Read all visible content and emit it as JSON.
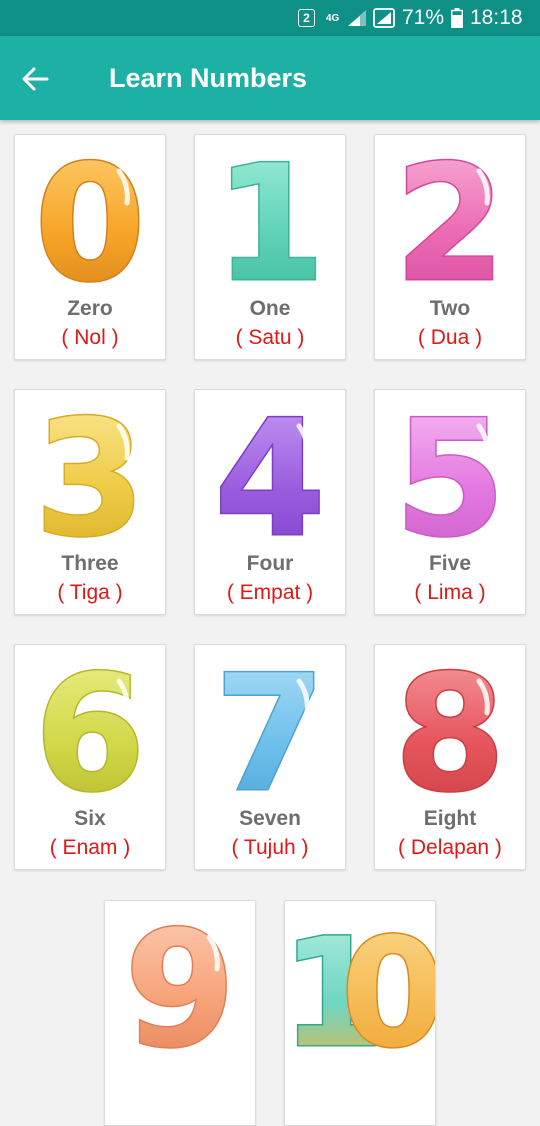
{
  "status_bar": {
    "sim_slot": "2",
    "network_type": "4G",
    "battery_percent": "71%",
    "time": "18:18",
    "icons": [
      "sim-slot-icon",
      "signal-icon",
      "data-icon",
      "battery-icon"
    ]
  },
  "app_bar": {
    "title": "Learn Numbers",
    "back_icon": "arrow-left-icon"
  },
  "cards": [
    {
      "digit": "0",
      "english": "Zero",
      "indonesian": "( Nol )",
      "color": "#f7a528",
      "light": "#ffd277",
      "dark": "#d6801a"
    },
    {
      "digit": "1",
      "english": "One",
      "indonesian": "( Satu )",
      "color": "#5fd3b8",
      "light": "#a6f0dd",
      "dark": "#3cb497"
    },
    {
      "digit": "2",
      "english": "Two",
      "indonesian": "( Dua )",
      "color": "#ec6bb3",
      "light": "#f9b5da",
      "dark": "#d3479a"
    },
    {
      "digit": "3",
      "english": "Three",
      "indonesian": "( Tiga )",
      "color": "#efcc46",
      "light": "#fbe99a",
      "dark": "#d5ac22"
    },
    {
      "digit": "4",
      "english": "Four",
      "indonesian": "( Empat )",
      "color": "#9b5de0",
      "light": "#c9a0f4",
      "dark": "#7a3fc4"
    },
    {
      "digit": "5",
      "english": "Five",
      "indonesian": "( Lima )",
      "color": "#e479e1",
      "light": "#f7c3f4",
      "dark": "#c95cc5"
    },
    {
      "digit": "6",
      "english": "Six",
      "indonesian": "( Enam )",
      "color": "#d2d848",
      "light": "#ecf08f",
      "dark": "#b3b82a"
    },
    {
      "digit": "7",
      "english": "Seven",
      "indonesian": "( Tujuh )",
      "color": "#6fc0ec",
      "light": "#b2e0f8",
      "dark": "#4aa3d4"
    },
    {
      "digit": "8",
      "english": "Eight",
      "indonesian": "( Delapan )",
      "color": "#e6555c",
      "light": "#f6a0a4",
      "dark": "#c93d44"
    },
    {
      "digit": "9",
      "english": "",
      "indonesian": "",
      "color": "#f7a37a",
      "light": "#fcd0b8",
      "dark": "#e07f55"
    },
    {
      "digit": "10",
      "english": "",
      "indonesian": "",
      "color": "#6ed6c2",
      "light": "#b3eee2",
      "dark": "#f4b23a"
    }
  ]
}
